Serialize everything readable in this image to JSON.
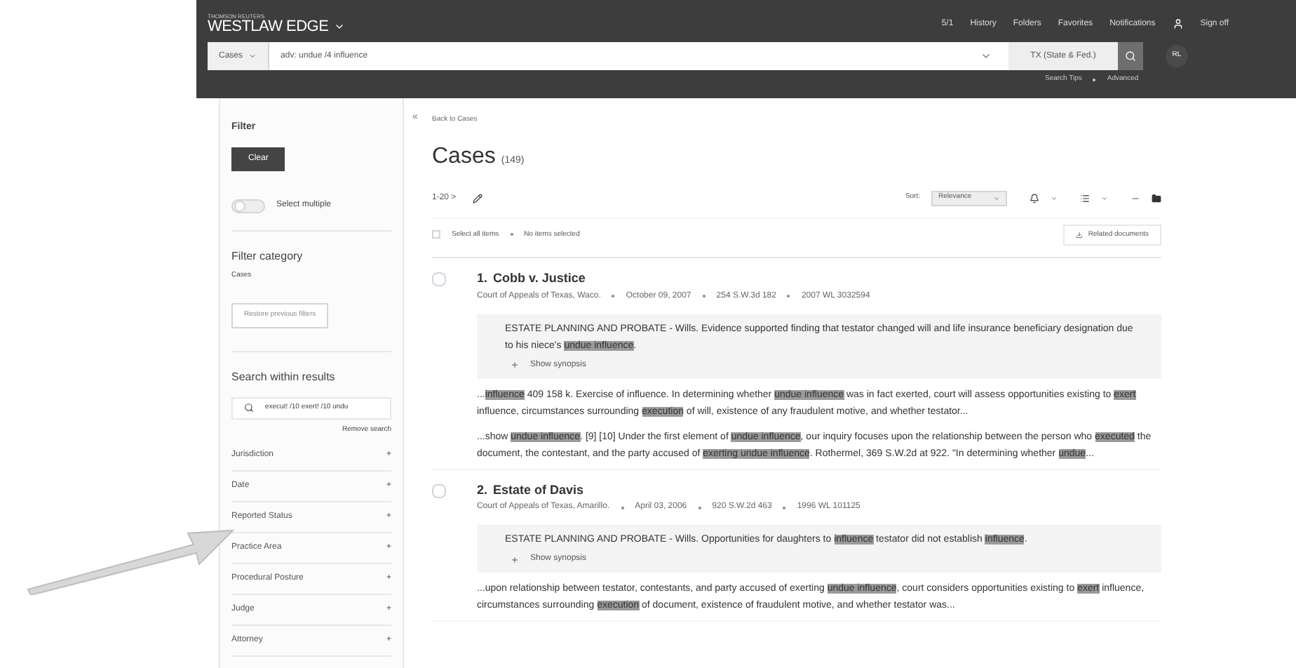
{
  "header": {
    "brand_small": "THOMSON REUTERS",
    "brand": "WESTLAW EDGE",
    "nav": [
      "5/1",
      "History",
      "Folders",
      "Favorites",
      "Notifications",
      "Sign off"
    ],
    "search": {
      "scope": "Cases",
      "query": "adv: undue /4 influence",
      "jurisdiction": "TX (State & Fed.)"
    },
    "user_initials": "RL",
    "links": [
      "Search Tips",
      "Advanced"
    ]
  },
  "sidebar": {
    "title": "Filter",
    "clear_button": "Clear",
    "select_multiple": {
      "label": "Select multiple",
      "on": false
    },
    "category_title": "Filter category",
    "category": "Cases",
    "restore_button": "Restore previous filters",
    "search_within": {
      "title": "Search within results",
      "value": "execut! /10 exert! /10 undu",
      "remove": "Remove search"
    },
    "filters": [
      {
        "label": "Jurisdiction",
        "expand": "+"
      },
      {
        "label": "Date",
        "expand": "+"
      },
      {
        "label": "Reported Status",
        "expand": "+"
      },
      {
        "label": "Practice Area",
        "expand": "+"
      },
      {
        "label": "Procedural Posture",
        "expand": "+"
      },
      {
        "label": "Judge",
        "expand": "+"
      },
      {
        "label": "Attorney",
        "expand": "+"
      }
    ],
    "collapse": "«"
  },
  "main": {
    "back_link": "Back to Cases",
    "title": "Cases",
    "count": "(149)",
    "range": "1-20 >",
    "sort_label": "Sort:",
    "sort_value": "Relevance",
    "select_all": "Select all items",
    "selection_status": "No items selected",
    "related_button": "Related documents",
    "results": [
      {
        "number": "1.",
        "title": "Cobb v. Justice",
        "checked": false,
        "meta": [
          "Court of Appeals of Texas, Waco.",
          "October 09, 2007",
          "254 S.W.3d 182",
          "2007 WL 3032594"
        ],
        "synopsis": "ESTATE PLANNING AND PROBATE - Wills. Evidence supported finding that testator changed will and life insurance beneficiary designation due to his niece's **undue influence**.",
        "show_synopsis": "Show synopsis",
        "snippets": [
          "...**influence** 409 158 k. Exercise of influence. In determining whether **undue influence** was in fact exerted, court will assess opportunities existing to **exert** influence, circumstances surrounding **execution** of will, existence of any fraudulent motive, and whether testator...",
          "...show **undue influence**. [9] [10]    Under the first element of **undue influence**, our inquiry focuses upon the relationship between the person who **executed** the document, the contestant, and the party accused of **exerting undue influence**. Rothermel, 369 S.W.2d at 922. \"In determining whether **undue**..."
        ]
      },
      {
        "number": "2.",
        "title": "Estate of Davis",
        "checked": false,
        "meta": [
          "Court of Appeals of Texas, Amarillo.",
          "April 03, 2006",
          "920 S.W.2d 463",
          "1996 WL 101125"
        ],
        "synopsis": "ESTATE PLANNING AND PROBATE - Wills. Opportunities for daughters to **influence** testator did not establish **influence**.",
        "show_synopsis": "Show synopsis",
        "snippets": [
          "...upon relationship between testator, contestants, and party accused of exerting **undue influence**, court considers opportunities existing to **exert** influence, circumstances surrounding **execution** of document, existence of fraudulent motive, and whether testator was..."
        ]
      }
    ]
  }
}
